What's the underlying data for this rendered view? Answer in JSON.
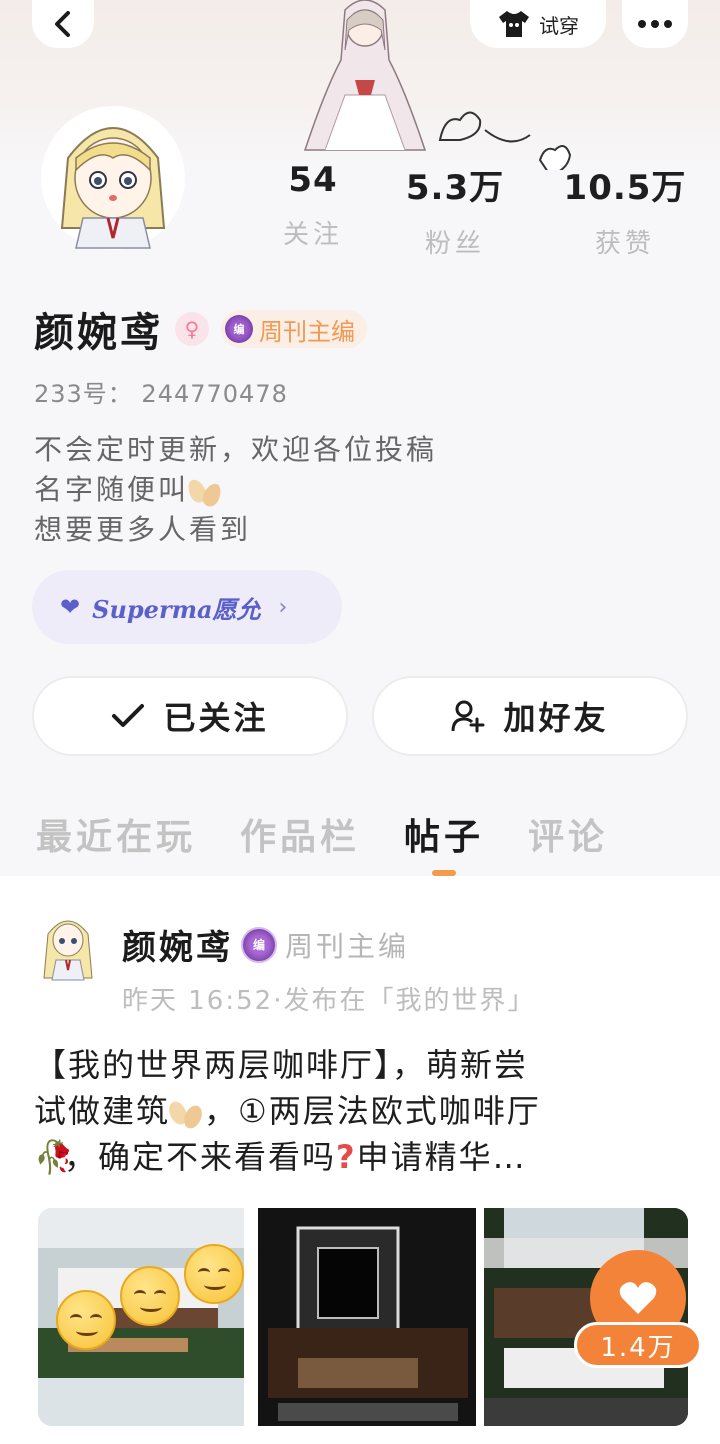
{
  "header": {
    "try_label": "试穿"
  },
  "profile": {
    "name": "颜婉鸢",
    "gender_symbol": "♀",
    "title_badge": "周刊主编",
    "id_line": "233号：  244770478",
    "bio_lines": [
      "不会定时更新，欢迎各位投稿",
      "名字随便叫",
      "想要更多人看到"
    ],
    "vip_label": "Superma愿允"
  },
  "stats": [
    {
      "value": "54",
      "label": "关注"
    },
    {
      "value": "5.3万",
      "label": "粉丝"
    },
    {
      "value": "10.5万",
      "label": "获赞"
    }
  ],
  "actions": {
    "follow_label": "已关注",
    "add_friend_label": "加好友"
  },
  "tabs": [
    "最近在玩",
    "作品栏",
    "帖子",
    "评论"
  ],
  "active_tab": "帖子",
  "post": {
    "author": "颜婉鸢",
    "author_title": "周刊主编",
    "meta": "昨天  16:52·发布在「我的世界」",
    "text_line1": "【我的世界两层咖啡厅】，萌新尝",
    "text_line2a": "试做建筑",
    "text_line2b": "，①两层法欧式咖啡厅",
    "text_line3a": "，确定不来看看吗",
    "text_line3b": "申请精华…",
    "like_count": "1.4万"
  },
  "colors": {
    "accent": "#f4833a",
    "vip": "#5a5fc9",
    "badge_text": "#f09a55"
  }
}
